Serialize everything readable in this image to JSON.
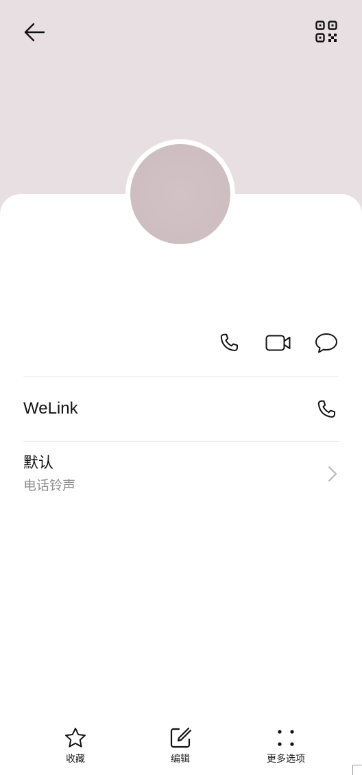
{
  "colors": {
    "header_background": "#e8dfe2",
    "avatar": "#cbbcc0",
    "text_primary": "#111111",
    "text_secondary": "#8d8d8d",
    "divider": "#e7e7e7"
  },
  "header": {
    "back_icon": "arrow-left-icon",
    "qr_icon": "qr-code-icon"
  },
  "quick_actions": [
    {
      "icon": "phone-icon"
    },
    {
      "icon": "video-call-icon"
    },
    {
      "icon": "message-icon"
    }
  ],
  "welink": {
    "label": "WeLink",
    "icon": "phone-icon"
  },
  "ringtone": {
    "value": "默认",
    "label": "电话铃声",
    "icon": "chevron-right-icon"
  },
  "bottom_bar": {
    "items": [
      {
        "label": "收藏",
        "icon": "star-icon"
      },
      {
        "label": "编辑",
        "icon": "edit-icon"
      },
      {
        "label": "更多选项",
        "icon": "more-options-icon"
      }
    ]
  }
}
